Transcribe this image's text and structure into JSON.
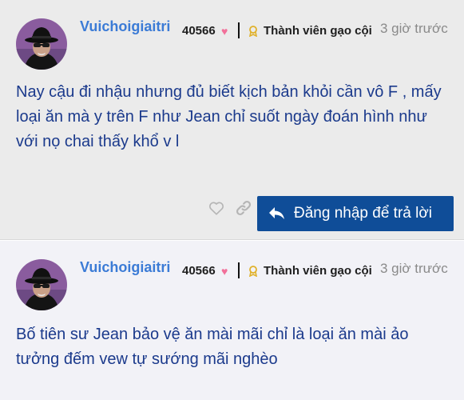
{
  "colors": {
    "username": "#3b7bd6",
    "body_text": "#1b3a8c",
    "heart": "#f2709a",
    "medal": "#e0b12a",
    "reply_button": "#0f4d98",
    "meta_time": "#8a8a8a"
  },
  "icons": {
    "heart": "heart-icon",
    "medal": "medal-icon",
    "like": "heart-outline-icon",
    "link": "link-icon",
    "reply": "reply-arrow-icon"
  },
  "posts": [
    {
      "username": "Vuichoigiaitri",
      "likes_count": "40566",
      "rank_title": "Thành viên gạo cội",
      "time_ago": "3 giờ trước",
      "body": "Nay cậu đi nhậu nhưng đủ biết kịch bản khỏi cần vô F , mấy loại ăn mà y trên F như Jean chỉ suốt ngày đoán hình như với nọ chai thấy khổ v l",
      "reply_label": "Đăng nhập để trả lời"
    },
    {
      "username": "Vuichoigiaitri",
      "likes_count": "40566",
      "rank_title": "Thành viên gạo cội",
      "time_ago": "3 giờ trước",
      "body": "Bố tiên sư Jean bảo vệ ăn mài mãi chỉ là loại ăn mài ảo tưởng đếm vew tự sướng mãi nghèo"
    }
  ]
}
